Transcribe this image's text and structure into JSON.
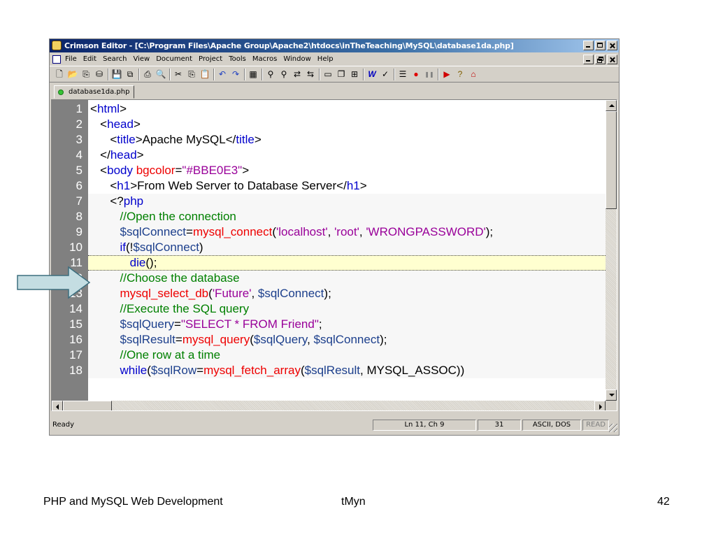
{
  "window": {
    "title": "Crimson Editor - [C:\\Program Files\\Apache Group\\Apache2\\htdocs\\inTheTeaching\\MySQL\\database1da.php]"
  },
  "menu": [
    "File",
    "Edit",
    "Search",
    "View",
    "Document",
    "Project",
    "Tools",
    "Macros",
    "Window",
    "Help"
  ],
  "toolbar_icons": [
    "new-file-icon",
    "open-file-icon",
    "open-project-icon",
    "open-remote-icon",
    "save-icon",
    "save-all-icon",
    "print-icon",
    "print-preview-icon",
    "cut-icon",
    "copy-icon",
    "paste-icon",
    "undo-icon",
    "redo-icon",
    "column-mode-icon",
    "find-icon",
    "find-next-icon",
    "replace-icon",
    "replace-all-icon",
    "window-tile-icon",
    "window-cascade-icon",
    "directory-icon",
    "word-wrap-icon",
    "spell-check-icon",
    "line-numbers-icon",
    "record-macro-icon",
    "pause-macro-icon",
    "play-macro-icon",
    "help-icon",
    "home-icon"
  ],
  "tab": {
    "label": "database1da.php"
  },
  "code_lines": [
    {
      "num": "1",
      "tokens": [
        [
          "c-black",
          "<"
        ],
        [
          "c-blue",
          "html"
        ],
        [
          "c-black",
          ">"
        ]
      ]
    },
    {
      "num": "2",
      "tokens": [
        [
          "c-black",
          "   <"
        ],
        [
          "c-blue",
          "head"
        ],
        [
          "c-black",
          ">"
        ]
      ]
    },
    {
      "num": "3",
      "tokens": [
        [
          "c-black",
          "      <"
        ],
        [
          "c-blue",
          "title"
        ],
        [
          "c-black",
          ">Apache MySQL</"
        ],
        [
          "c-blue",
          "title"
        ],
        [
          "c-black",
          ">"
        ]
      ]
    },
    {
      "num": "4",
      "tokens": [
        [
          "c-black",
          "   </"
        ],
        [
          "c-blue",
          "head"
        ],
        [
          "c-black",
          ">"
        ]
      ]
    },
    {
      "num": "5",
      "tokens": [
        [
          "c-black",
          "   <"
        ],
        [
          "c-blue",
          "body "
        ],
        [
          "c-red",
          "bgcolor"
        ],
        [
          "c-black",
          "="
        ],
        [
          "c-purple",
          "\"#BBE0E3\""
        ],
        [
          "c-black",
          ">"
        ]
      ]
    },
    {
      "num": "6",
      "tokens": [
        [
          "c-black",
          "      <"
        ],
        [
          "c-blue",
          "h1"
        ],
        [
          "c-black",
          ">From Web Server to Database Server</"
        ],
        [
          "c-blue",
          "h1"
        ],
        [
          "c-black",
          ">"
        ]
      ]
    },
    {
      "num": "7",
      "tokens": [
        [
          "c-black",
          "      <?"
        ],
        [
          "c-blue",
          "php"
        ]
      ]
    },
    {
      "num": "8",
      "tokens": [
        [
          "c-green",
          "         //Open the connection"
        ]
      ]
    },
    {
      "num": "9",
      "tokens": [
        [
          "c-dblue",
          "         $sqlConnect"
        ],
        [
          "c-black",
          "="
        ],
        [
          "c-red",
          "mysql_connect"
        ],
        [
          "c-black",
          "("
        ],
        [
          "c-purple",
          "'localhost'"
        ],
        [
          "c-black",
          ", "
        ],
        [
          "c-purple",
          "'root'"
        ],
        [
          "c-black",
          ", "
        ],
        [
          "c-purple",
          "'WRONGPASSWORD'"
        ],
        [
          "c-black",
          ");"
        ]
      ]
    },
    {
      "num": "10",
      "tokens": [
        [
          "c-blue",
          "         if"
        ],
        [
          "c-black",
          "(!"
        ],
        [
          "c-dblue",
          "$sqlConnect"
        ],
        [
          "c-black",
          ")"
        ]
      ]
    },
    {
      "num": "11",
      "tokens": [
        [
          "c-blue",
          "            die"
        ],
        [
          "c-black",
          "();"
        ]
      ]
    },
    {
      "num": "12",
      "tokens": [
        [
          "c-green",
          "         //Choose the database"
        ]
      ]
    },
    {
      "num": "13",
      "tokens": [
        [
          "c-red",
          "         mysql_select_db"
        ],
        [
          "c-black",
          "("
        ],
        [
          "c-purple",
          "'Future'"
        ],
        [
          "c-black",
          ", "
        ],
        [
          "c-dblue",
          "$sqlConnect"
        ],
        [
          "c-black",
          ");"
        ]
      ]
    },
    {
      "num": "14",
      "tokens": [
        [
          "c-green",
          "         //Execute the SQL query"
        ]
      ]
    },
    {
      "num": "15",
      "tokens": [
        [
          "c-dblue",
          "         $sqlQuery"
        ],
        [
          "c-black",
          "="
        ],
        [
          "c-purple",
          "\"SELECT * FROM Friend\""
        ],
        [
          "c-black",
          ";"
        ]
      ]
    },
    {
      "num": "16",
      "tokens": [
        [
          "c-dblue",
          "         $sqlResult"
        ],
        [
          "c-black",
          "="
        ],
        [
          "c-red",
          "mysql_query"
        ],
        [
          "c-black",
          "("
        ],
        [
          "c-dblue",
          "$sqlQuery"
        ],
        [
          "c-black",
          ", "
        ],
        [
          "c-dblue",
          "$sqlConnect"
        ],
        [
          "c-black",
          ");"
        ]
      ]
    },
    {
      "num": "17",
      "tokens": [
        [
          "c-green",
          "         //One row at a time"
        ]
      ]
    },
    {
      "num": "18",
      "tokens": [
        [
          "c-blue",
          "         while"
        ],
        [
          "c-black",
          "("
        ],
        [
          "c-dblue",
          "$sqlRow"
        ],
        [
          "c-black",
          "="
        ],
        [
          "c-red",
          "mysql_fetch_array"
        ],
        [
          "c-black",
          "("
        ],
        [
          "c-dblue",
          "$sqlResult"
        ],
        [
          "c-black",
          ", MYSQL_ASSOC))"
        ]
      ]
    }
  ],
  "status": {
    "ready": "Ready",
    "position": "Ln 11, Ch 9",
    "col": "31",
    "encoding": "ASCII, DOS",
    "mode": "READ"
  },
  "footer": {
    "left": "PHP and MySQL Web Development",
    "center": "tMyn",
    "page": "42"
  }
}
